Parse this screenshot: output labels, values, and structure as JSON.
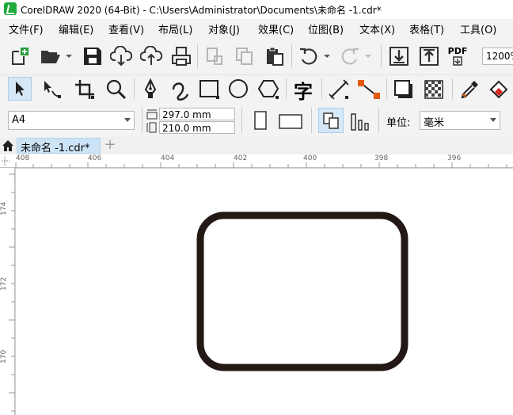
{
  "window": {
    "title": "CorelDRAW 2020 (64-Bit) - C:\\Users\\Administrator\\Documents\\未命名 -1.cdr*"
  },
  "menu": [
    {
      "label": "文件(F)"
    },
    {
      "label": "编辑(E)"
    },
    {
      "label": "查看(V)"
    },
    {
      "label": "布局(L)"
    },
    {
      "label": "对象(J)"
    },
    {
      "label": "效果(C)"
    },
    {
      "label": "位图(B)"
    },
    {
      "label": "文本(X)"
    },
    {
      "label": "表格(T)"
    },
    {
      "label": "工具(O)"
    }
  ],
  "toolbar": {
    "pdf_label": "PDF",
    "zoom": "1200%"
  },
  "toolbox": {
    "text_tool_glyph": "字"
  },
  "property_bar": {
    "page_size": "A4",
    "width": "297.0 mm",
    "height": "210.0 mm",
    "unit_label": "单位:",
    "unit_value": "毫米"
  },
  "tabs": {
    "document": "未命名 -1.cdr*",
    "add": "+"
  },
  "ruler": {
    "horizontal_labels": [
      "408",
      "406",
      "404",
      "402",
      "400",
      "398",
      "396"
    ],
    "vertical_labels": [
      "174",
      "172",
      "170"
    ]
  },
  "colors": {
    "app_green": "#1faa3a",
    "tab_active": "#cde4f7",
    "shape_outline": "#231815",
    "accent_orange": "#e35a0c",
    "accent_red": "#d9261c"
  }
}
